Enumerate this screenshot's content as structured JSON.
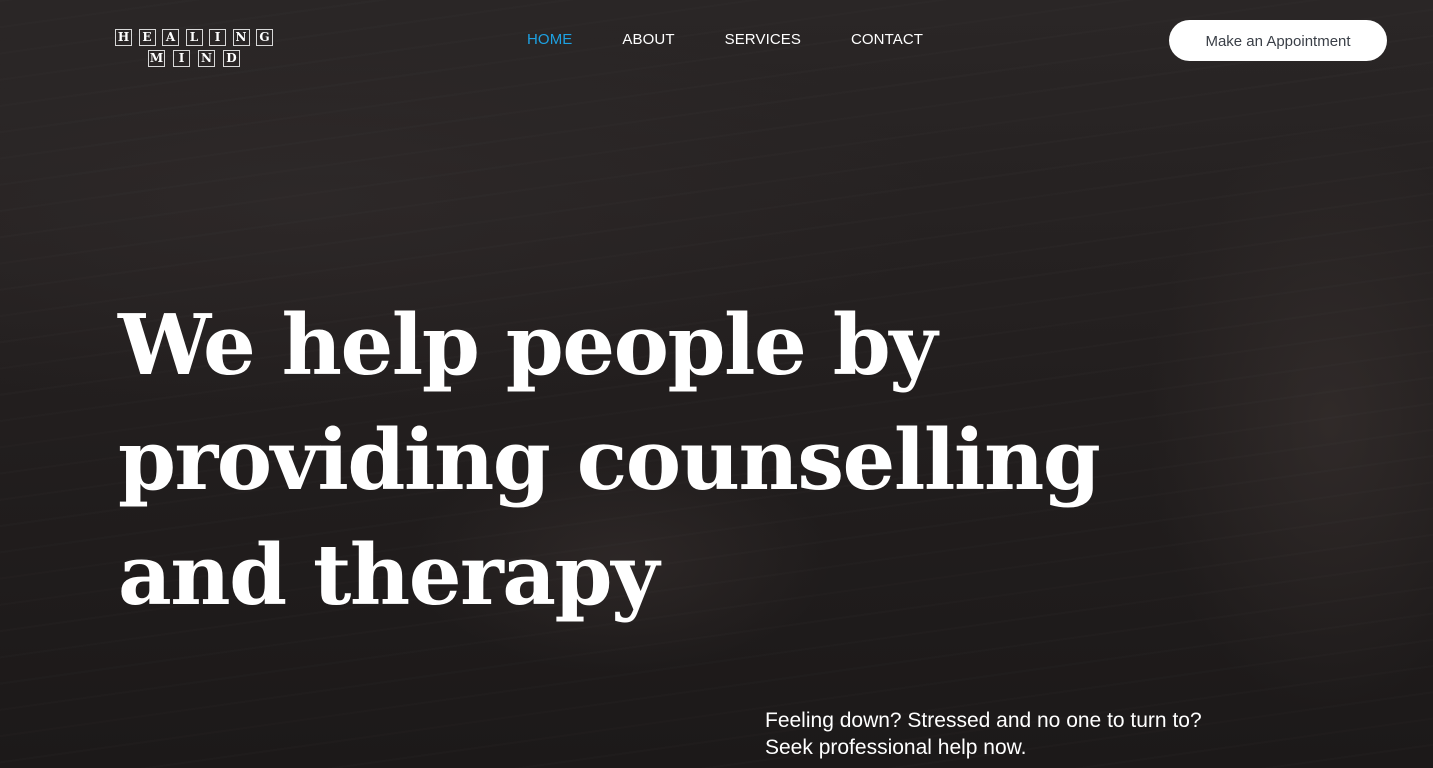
{
  "logo": {
    "row1": [
      "H",
      "E",
      "A",
      "L",
      "I",
      "N",
      "G"
    ],
    "row2": [
      "M",
      "I",
      "N",
      "D"
    ]
  },
  "nav": {
    "items": [
      {
        "label": "HOME",
        "active": true
      },
      {
        "label": "ABOUT",
        "active": false
      },
      {
        "label": "SERVICES",
        "active": false
      },
      {
        "label": "CONTACT",
        "active": false
      }
    ]
  },
  "header": {
    "appointment_label": "Make an Appointment"
  },
  "hero": {
    "headline_lines": [
      "We help people by",
      "providing counselling",
      "and therapy"
    ],
    "tagline_lines": [
      "Feeling down? Stressed and no one to turn to?",
      "Seek professional help now."
    ]
  },
  "colors": {
    "accent": "#1da1e2",
    "text": "#ffffff",
    "button_bg": "#ffffff",
    "button_text": "#3a3f47"
  }
}
